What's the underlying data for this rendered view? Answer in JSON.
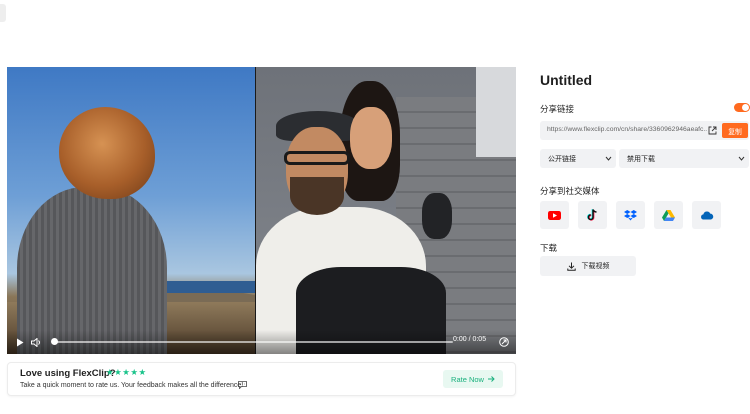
{
  "player": {
    "time": "0:00 / 0:05",
    "progress": 0
  },
  "rating": {
    "title": "Love using FlexClip?",
    "stars": "★★★★★",
    "subtitle": "Take a quick moment to rate us. Your feedback makes all the difference!",
    "button_label": "Rate Now"
  },
  "panel": {
    "title": "Untitled",
    "share_link_label": "分享链接",
    "share_link_enabled": true,
    "link_url": "https://www.flexclip.com/cn/share/3360962946aeafc...",
    "copy_label": "复制",
    "visibility_value": "公开链接",
    "download_permission_value": "禁用下载",
    "social_label": "分享到社交媒体",
    "social": [
      "youtube-icon",
      "tiktok-icon",
      "dropbox-icon",
      "google-drive-icon",
      "onedrive-icon"
    ],
    "download_label": "下载",
    "download_button_label": "下载视频"
  },
  "colors": {
    "accent": "#ff6a1f",
    "rate_green": "#19c38a",
    "panel_bg": "#f1f2f4"
  }
}
